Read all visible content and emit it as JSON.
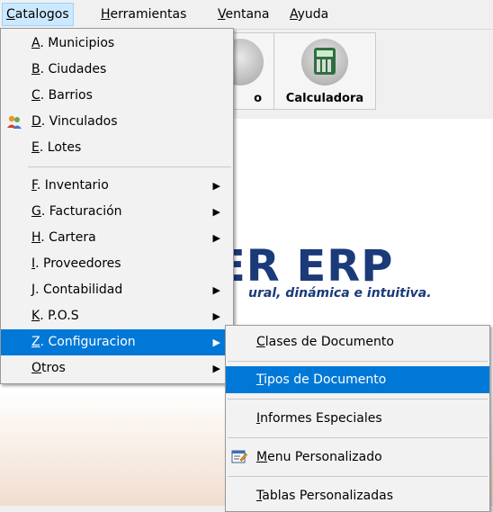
{
  "menubar": {
    "items": [
      {
        "key": "C",
        "rest": "atalogos"
      },
      {
        "key": "H",
        "rest": "erramientas"
      },
      {
        "key": "V",
        "rest": "entana"
      },
      {
        "key": "A",
        "rest": "yuda"
      }
    ]
  },
  "toolbar": {
    "partial_label": "o",
    "calculator_label": "Calculadora"
  },
  "logo": {
    "text": "ER ERP",
    "tagline": "ural, dinámica e intuitiva."
  },
  "catalogos_menu": {
    "items": [
      {
        "key": "A",
        "rest": ". Municipios",
        "submenu": false
      },
      {
        "key": "B",
        "rest": ". Ciudades",
        "submenu": false
      },
      {
        "key": "C",
        "rest": ". Barrios",
        "submenu": false
      },
      {
        "key": "D",
        "rest": ". Vinculados",
        "submenu": false,
        "icon": "people-icon"
      },
      {
        "key": "E",
        "rest": ". Lotes",
        "submenu": false
      },
      {
        "key": "F",
        "rest": ".  Inventario",
        "submenu": true
      },
      {
        "key": "G",
        "rest": ". Facturación",
        "submenu": true
      },
      {
        "key": "H",
        "rest": ". Cartera",
        "submenu": true
      },
      {
        "key": "I",
        "rest": ".  Proveedores",
        "submenu": false
      },
      {
        "key": "J",
        "rest": ". Contabilidad",
        "submenu": true
      },
      {
        "key": "K",
        "rest": ". P.O.S",
        "submenu": true
      },
      {
        "key": "Z",
        "rest": ". Configuracion",
        "submenu": true,
        "selected": true
      },
      {
        "key": "O",
        "rest": "tros",
        "submenu": true
      }
    ]
  },
  "configuracion_menu": {
    "items": [
      {
        "key": "C",
        "rest": "lases de Documento"
      },
      {
        "key": "T",
        "rest": "ipos de Documento",
        "selected": true
      },
      {
        "key": "I",
        "rest": "nformes Especiales"
      },
      {
        "key": "M",
        "rest": "enu Personalizado",
        "icon": "custom-menu-icon"
      },
      {
        "key": "T",
        "rest": "ablas Personalizadas"
      }
    ]
  },
  "colors": {
    "menu_highlight": "#0078d7",
    "menubar_active": "#cce8ff",
    "logo_blue": "#1b3a7a"
  }
}
